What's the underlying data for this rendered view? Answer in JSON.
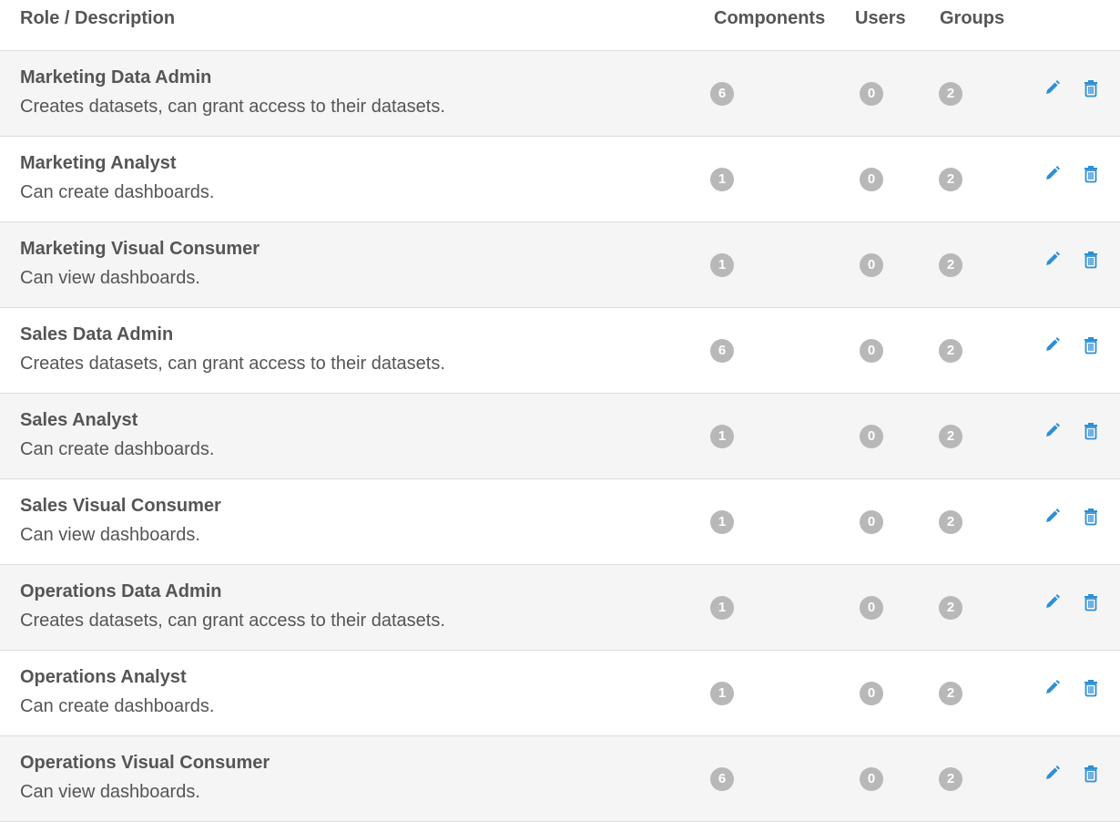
{
  "table": {
    "headers": {
      "role": "Role / Description",
      "components": "Components",
      "users": "Users",
      "groups": "Groups"
    },
    "rows": [
      {
        "name": "Marketing Data Admin",
        "description": "Creates datasets, can grant access to their datasets.",
        "components": "6",
        "users": "0",
        "groups": "2"
      },
      {
        "name": "Marketing Analyst",
        "description": "Can create dashboards.",
        "components": "1",
        "users": "0",
        "groups": "2"
      },
      {
        "name": "Marketing Visual Consumer",
        "description": "Can view dashboards.",
        "components": "1",
        "users": "0",
        "groups": "2"
      },
      {
        "name": "Sales Data Admin",
        "description": "Creates datasets, can grant access to their datasets.",
        "components": "6",
        "users": "0",
        "groups": "2"
      },
      {
        "name": "Sales Analyst",
        "description": "Can create dashboards.",
        "components": "1",
        "users": "0",
        "groups": "2"
      },
      {
        "name": "Sales Visual Consumer",
        "description": "Can view dashboards.",
        "components": "1",
        "users": "0",
        "groups": "2"
      },
      {
        "name": "Operations Data Admin",
        "description": "Creates datasets, can grant access to their datasets.",
        "components": "1",
        "users": "0",
        "groups": "2"
      },
      {
        "name": "Operations Analyst",
        "description": "Can create dashboards.",
        "components": "1",
        "users": "0",
        "groups": "2"
      },
      {
        "name": "Operations Visual Consumer",
        "description": "Can view dashboards.",
        "components": "6",
        "users": "0",
        "groups": "2"
      }
    ]
  },
  "icons": {
    "edit": "pencil-icon",
    "delete": "trash-icon"
  },
  "colors": {
    "text": "#555555",
    "badge": "#b8b8b8",
    "action": "#2e8fd4",
    "row_alt": "#f5f5f5",
    "border": "#dddddd"
  }
}
